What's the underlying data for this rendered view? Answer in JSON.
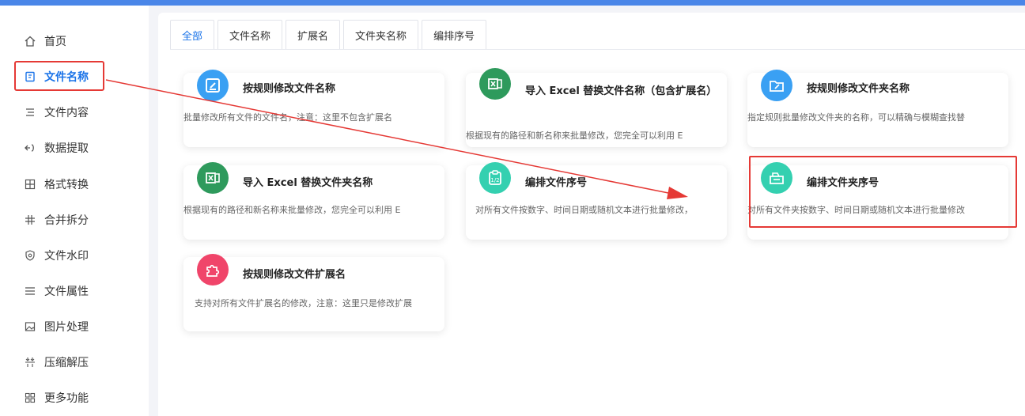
{
  "sidebar": {
    "items": [
      {
        "label": "首页",
        "icon": "home-icon"
      },
      {
        "label": "文件名称",
        "icon": "file-rename-icon"
      },
      {
        "label": "文件内容",
        "icon": "file-content-icon"
      },
      {
        "label": "数据提取",
        "icon": "data-extract-icon"
      },
      {
        "label": "格式转换",
        "icon": "format-convert-icon"
      },
      {
        "label": "合并拆分",
        "icon": "merge-split-icon"
      },
      {
        "label": "文件水印",
        "icon": "watermark-icon"
      },
      {
        "label": "文件属性",
        "icon": "file-attribute-icon"
      },
      {
        "label": "图片处理",
        "icon": "image-icon"
      },
      {
        "label": "压缩解压",
        "icon": "compress-icon"
      },
      {
        "label": "更多功能",
        "icon": "more-icon"
      }
    ],
    "active_index": 1
  },
  "tabs": [
    {
      "label": "全部"
    },
    {
      "label": "文件名称"
    },
    {
      "label": "扩展名"
    },
    {
      "label": "文件夹名称"
    },
    {
      "label": "编排序号"
    }
  ],
  "cards": [
    {
      "title": "按规则修改文件名称",
      "desc": "批量修改所有文件的文件名，注意：这里不包含扩展名",
      "icon": "edit-document-icon"
    },
    {
      "title": "导入 Excel 替换文件名称（包含扩展名）",
      "desc": "根据现有的路径和新名称来批量修改，您完全可以利用 E",
      "icon": "excel-icon"
    },
    {
      "title": "按规则修改文件夹名称",
      "desc": "指定规则批量修改文件夹的名称，可以精确与模糊查找替",
      "icon": "folder-edit-icon"
    },
    {
      "title": "导入 Excel 替换文件夹名称",
      "desc": "根据现有的路径和新名称来批量修改，您完全可以利用 E",
      "icon": "excel-icon"
    },
    {
      "title": "编排文件序号",
      "desc": "对所有文件按数字、时间日期或随机文本进行批量修改，",
      "icon": "clipboard-number-icon"
    },
    {
      "title": "编排文件夹序号",
      "desc": "对所有文件夹按数字、时间日期或随机文本进行批量修改",
      "icon": "folder-number-icon"
    },
    {
      "title": "按规则修改文件扩展名",
      "desc": "支持对所有文件扩展名的修改，注意：这里只是修改扩展",
      "icon": "puzzle-icon"
    }
  ],
  "colors": {
    "accent": "#1a73e8",
    "highlight": "#e53935",
    "icon_blue": "#3aa0f3",
    "icon_green": "#2e9a5c",
    "icon_teal": "#34d0b0",
    "icon_pink": "#f0456a"
  }
}
